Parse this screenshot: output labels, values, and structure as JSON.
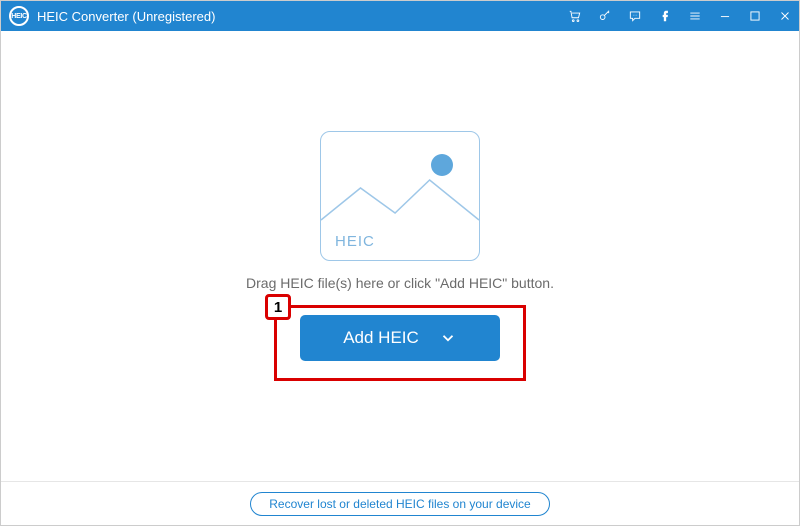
{
  "header": {
    "logo_text": "HEIC",
    "title": "HEIC Converter (Unregistered)"
  },
  "main": {
    "placeholder_label": "HEIC",
    "drag_text": "Drag HEIC file(s) here or click \"Add HEIC\" button.",
    "add_button_label": "Add HEIC",
    "callout_number": "1"
  },
  "footer": {
    "recover_text": "Recover lost or deleted HEIC files on your device"
  }
}
